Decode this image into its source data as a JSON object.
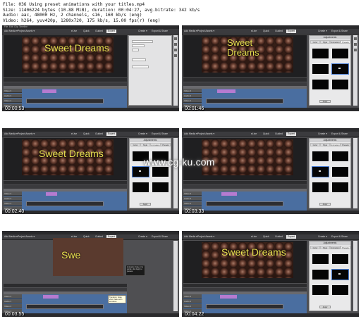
{
  "file_info": {
    "line1": "File: 036 Using preset animations with your titles.mp4",
    "line2": "Size: 11406224 bytes (10.88 MiB), duration: 00:04:27, avg.bitrate: 342 kb/s",
    "line3": "Audio: aac, 48000 Hz, 2 channels, s16, 160 kb/s (eng)",
    "line4": "Video: h264, yuv420p, 1280x720, 175 kb/s, 15.00 fps(r) (eng)"
  },
  "app": {
    "menus": [
      "File",
      "Edit",
      "Clip",
      "Timeline",
      "Text",
      "Tools",
      "Window",
      "Help"
    ],
    "add_media": "Add Media ▾",
    "project_assets": "Project Assets ▾",
    "modes": [
      "eLive",
      "Quick",
      "Guided",
      "Expert"
    ],
    "active_mode": "Expert",
    "create": "Create ▾",
    "export_share": "Export & Share",
    "panel_title": "Adjustments",
    "panel_tabs": [
      "Color",
      "Style",
      "Animation",
      "Presets"
    ],
    "track_labels": [
      "Video 3",
      "Audio 3",
      "Video 2",
      "Audio 2",
      "Video 1"
    ],
    "apply_label": "Apply",
    "title_text": "Sweet Dreams",
    "title_partial": "Swe",
    "tooltip_text": "Transition: Scale effect, fade out/in animation",
    "dark_tip_text": "Animation: Fade in by words; click Apply to preview"
  },
  "timestamps": [
    "00:00:53",
    "00:01:46",
    "00:02:40",
    "00:03:33",
    "00:03:55",
    "00:04:22"
  ],
  "watermark": "www.cg-ku.com",
  "colors": {
    "title_yellow": "#e8e050",
    "timeline_blue": "#4a6ea0",
    "title_clip": "#b67bd0",
    "ui_dark": "#4f4f52"
  }
}
